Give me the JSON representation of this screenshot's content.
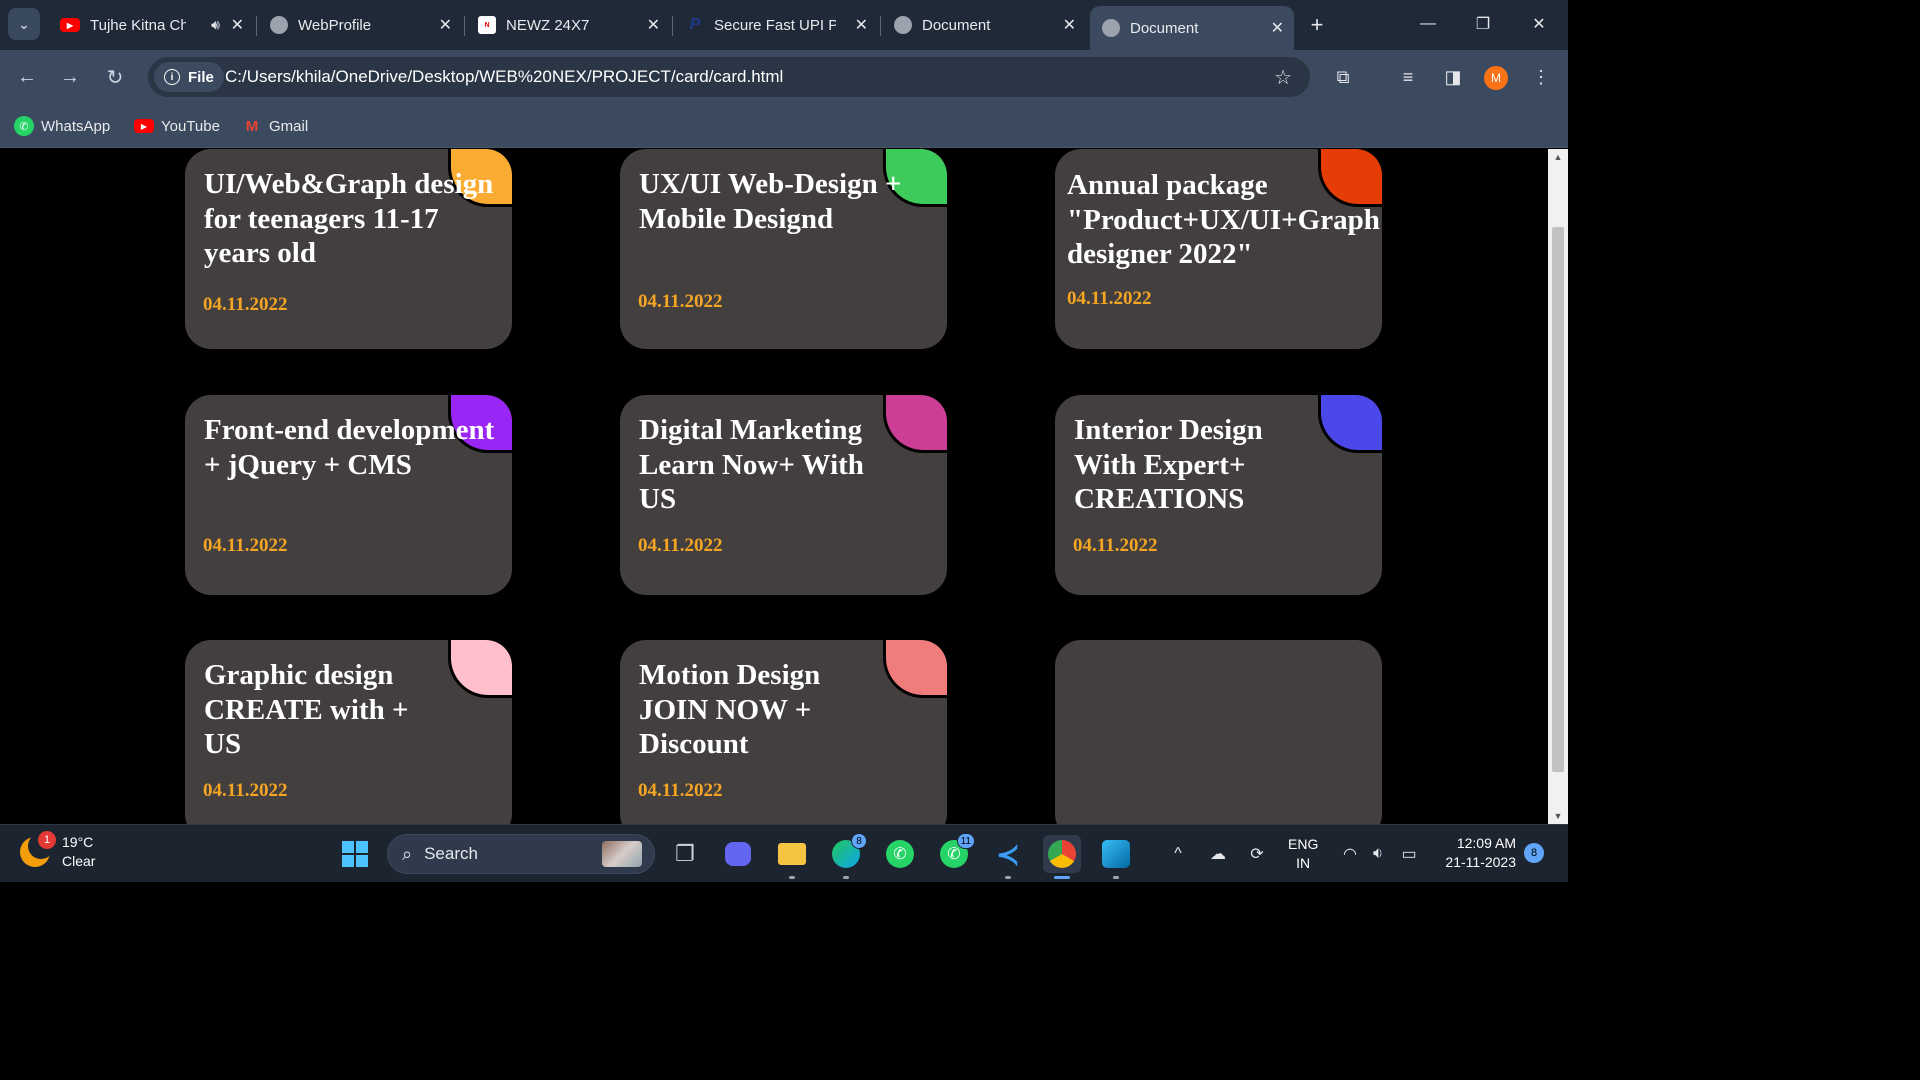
{
  "browser": {
    "tabs": [
      {
        "title": "Tujhe Kitna Ch",
        "favicon": "youtube-icon",
        "active": false
      },
      {
        "title": "WebProfile",
        "favicon": "globe-icon",
        "active": false
      },
      {
        "title": "NEWZ 24X7",
        "favicon": "news-icon",
        "active": false
      },
      {
        "title": "Secure Fast UPI Pa",
        "favicon": "paypal-icon",
        "active": false
      },
      {
        "title": "Document",
        "favicon": "globe-icon",
        "active": false
      },
      {
        "title": "Document",
        "favicon": "globe-icon",
        "active": true
      }
    ],
    "address": {
      "scheme_label": "File",
      "url": "C:/Users/khila/OneDrive/Desktop/WEB%20NEX/PROJECT/card/card.html"
    },
    "profile_initial": "M",
    "bookmarks": [
      {
        "label": "WhatsApp",
        "icon": "whatsapp-icon"
      },
      {
        "label": "YouTube",
        "icon": "youtube-icon"
      },
      {
        "label": "Gmail",
        "icon": "gmail-icon"
      }
    ]
  },
  "cards": [
    {
      "title": "UI/Web&Graph design for teenagers 11-17 years old",
      "date": "04.11.2022",
      "corner_color": "#f9ab32"
    },
    {
      "title": "UX/UI Web-Design + Mobile Designd",
      "date": "04.11.2022",
      "corner_color": "#3dcc5b"
    },
    {
      "title": "Annual package \"Product+UX/UI+Graph designer 2022\"",
      "date": "04.11.2022",
      "corner_color": "#e63d06"
    },
    {
      "title": "Front-end development + jQuery + CMS",
      "date": "04.11.2022",
      "corner_color": "#9a26f5"
    },
    {
      "title": "Digital Marketing Learn Now+ With US",
      "date": "04.11.2022",
      "corner_color": "#cc3d96"
    },
    {
      "title": "Interior Design With Expert+ CREATIONS",
      "date": "04.11.2022",
      "corner_color": "#4b47e8"
    },
    {
      "title": "Graphic design CREATE with + US",
      "date": "04.11.2022",
      "corner_color": "#ffc0cb"
    },
    {
      "title": "Motion Design JOIN NOW + Discount",
      "date": "04.11.2022",
      "corner_color": "#f07c7c"
    },
    {
      "title": "",
      "date": "",
      "corner_color": ""
    }
  ],
  "taskbar": {
    "weather": {
      "temp": "19°C",
      "condition": "Clear",
      "badge": "1"
    },
    "search_placeholder": "Search",
    "apps": [
      {
        "name": "task-view-icon",
        "badge": ""
      },
      {
        "name": "teams-icon",
        "badge": ""
      },
      {
        "name": "file-explorer-icon",
        "badge": ""
      },
      {
        "name": "edge-icon",
        "badge": "8"
      },
      {
        "name": "whatsapp-icon",
        "badge": ""
      },
      {
        "name": "whatsapp-icon",
        "badge": "11"
      },
      {
        "name": "vscode-icon",
        "badge": ""
      },
      {
        "name": "chrome-icon",
        "badge": ""
      },
      {
        "name": "photos-icon",
        "badge": ""
      }
    ],
    "language": {
      "line1": "ENG",
      "line2": "IN"
    },
    "clock": {
      "time": "12:09 AM",
      "date": "21-11-2023"
    },
    "notification_count": "8"
  }
}
